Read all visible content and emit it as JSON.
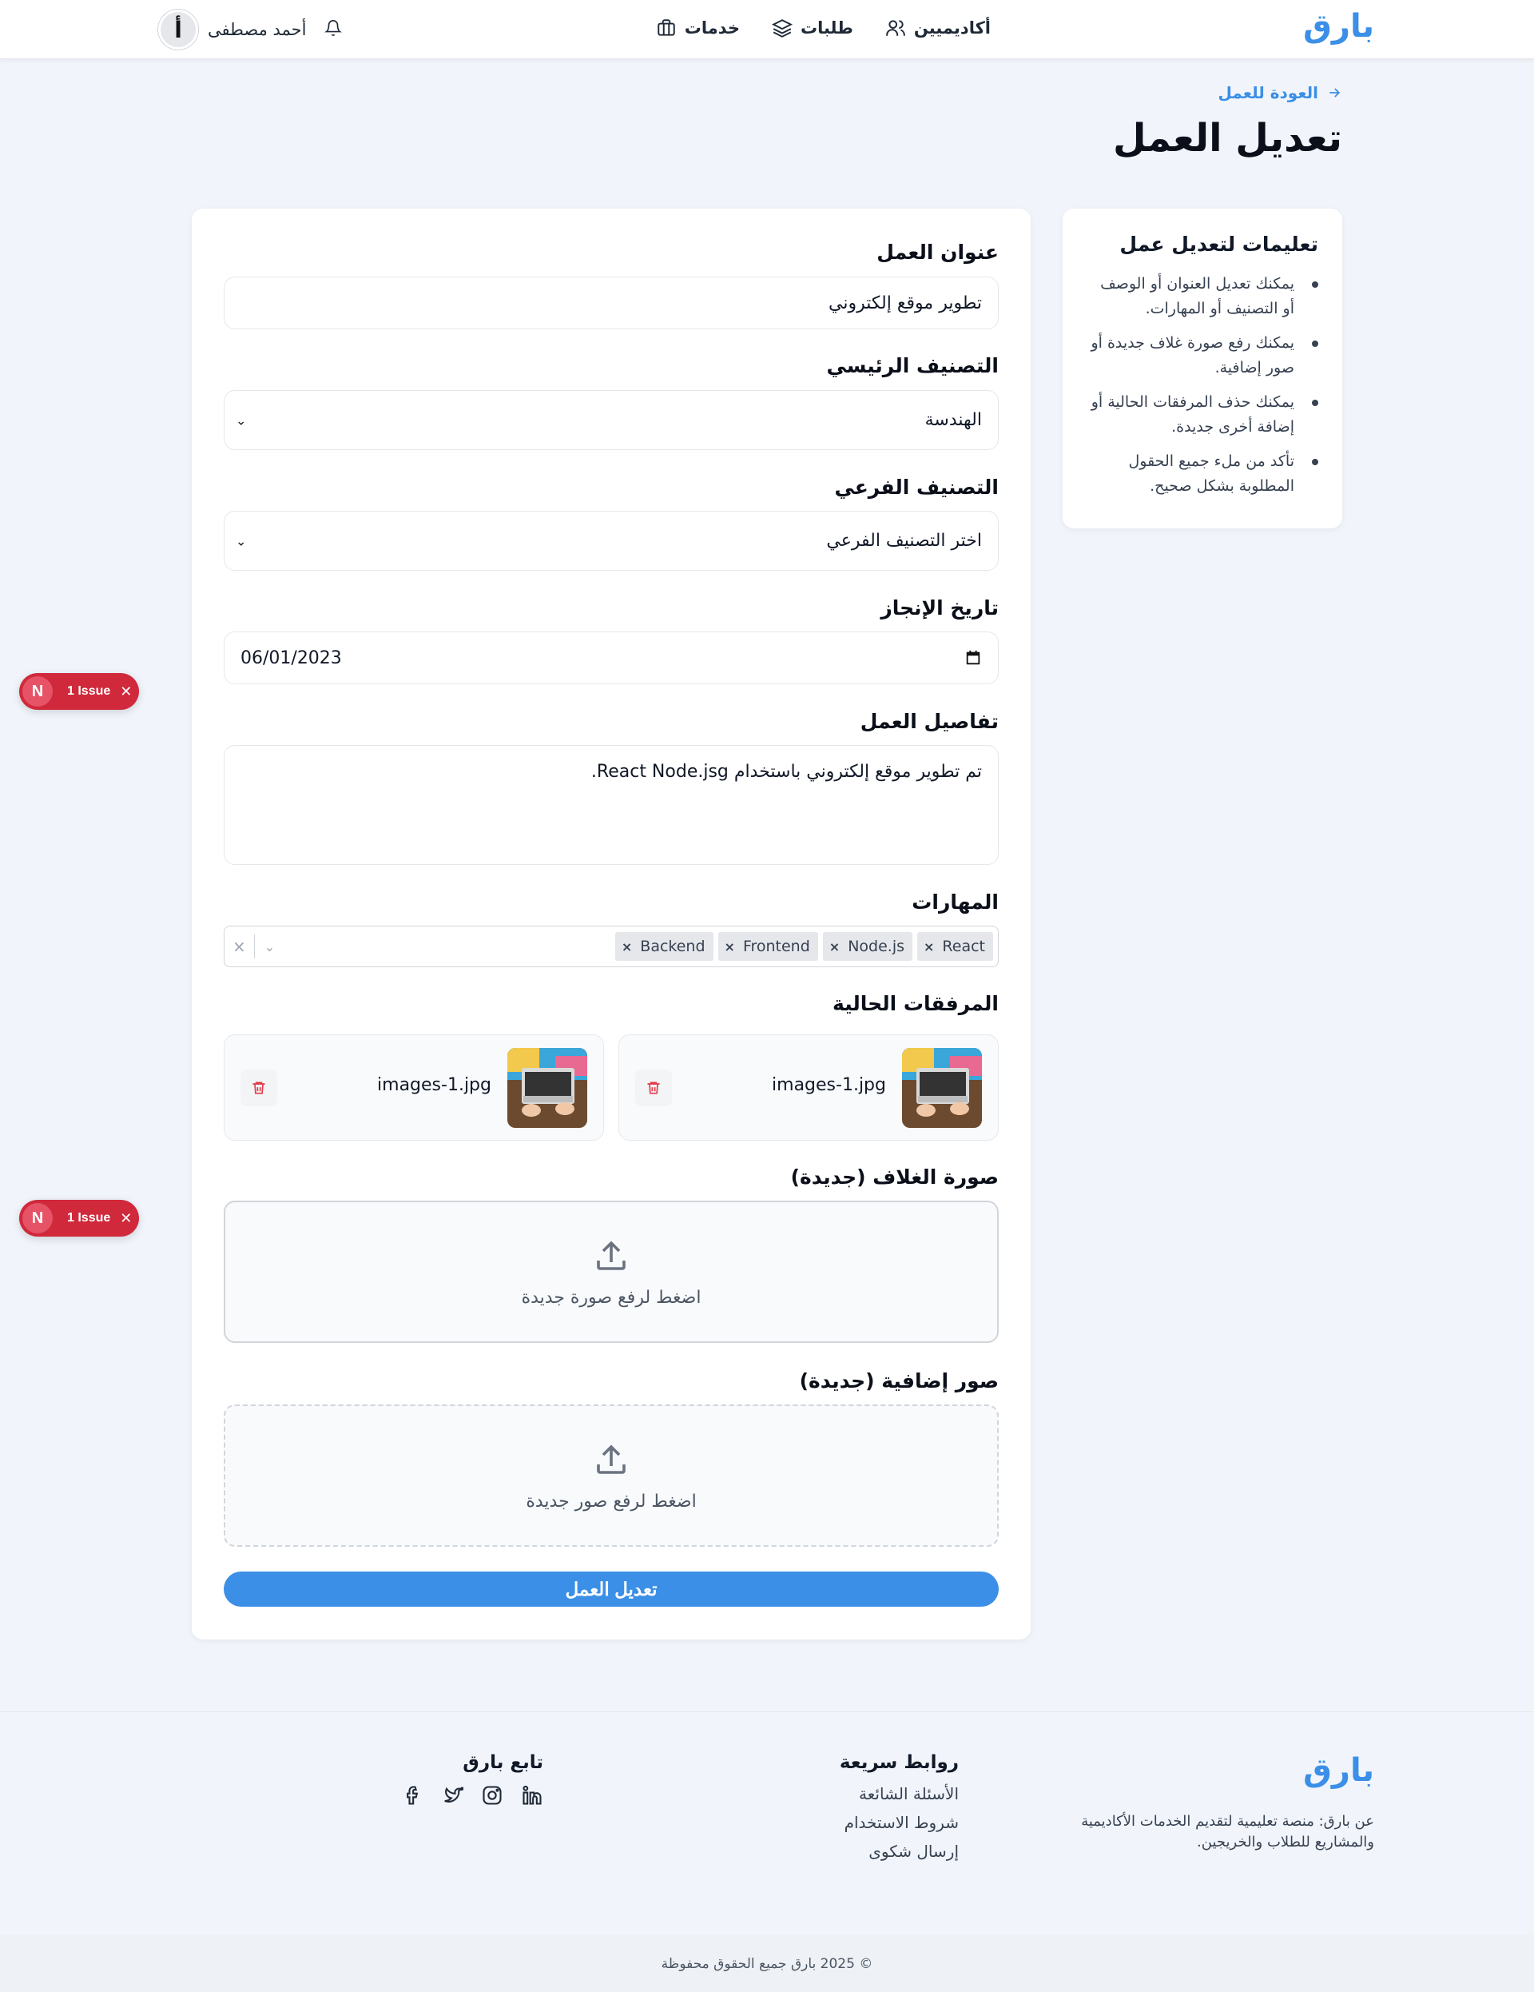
{
  "header": {
    "logo": "بارق",
    "nav": [
      {
        "label": "خدمات",
        "icon": "briefcase-icon"
      },
      {
        "label": "طلبات",
        "icon": "layers-icon"
      },
      {
        "label": "أكاديميين",
        "icon": "users-icon"
      }
    ],
    "user_name": "أحمد مصطفى",
    "avatar_letter": "أ"
  },
  "back_link": "العودة للعمل",
  "page_title": "تعديل العمل",
  "instructions": {
    "title": "تعليمات لتعديل عمل",
    "items": [
      "يمكنك تعديل العنوان أو الوصف أو التصنيف أو المهارات.",
      "يمكنك رفع صورة غلاف جديدة أو صور إضافية.",
      "يمكنك حذف المرفقات الحالية أو إضافة أخرى جديدة.",
      "تأكد من ملء جميع الحقول المطلوبة بشكل صحيح."
    ]
  },
  "form": {
    "title_label": "عنوان العمل",
    "title_value": "تطوير موقع إلكتروني",
    "main_category_label": "التصنيف الرئيسي",
    "main_category_value": "الهندسة",
    "sub_category_label": "التصنيف الفرعي",
    "sub_category_value": "اختر التصنيف الفرعي",
    "date_label": "تاريخ الإنجاز",
    "date_value": "06/01/2023",
    "details_label": "تفاصيل العمل",
    "details_value": "تم تطوير موقع إلكتروني باستخدام React Node.jsg.",
    "skills_label": "المهارات",
    "skills": [
      "React",
      "Node.js",
      "Frontend",
      "Backend"
    ],
    "attachments_label": "المرفقات الحالية",
    "attachments": [
      {
        "name": "images-1.jpg"
      },
      {
        "name": "images-1.jpg"
      }
    ],
    "cover_label": "صورة الغلاف (جديدة)",
    "cover_upload_text": "اضغط لرفع صورة جديدة",
    "extra_label": "صور إضافية (جديدة)",
    "extra_upload_text": "اضغط لرفع صور جديدة",
    "submit_label": "تعديل العمل"
  },
  "issues": {
    "letter": "N",
    "label": "1 Issue"
  },
  "footer": {
    "logo": "بارق",
    "about": "عن بارق: منصة تعليمية لتقديم الخدمات الأكاديمية والمشاريع للطلاب والخريجين.",
    "links_title": "روابط سريعة",
    "links": [
      "الأسئلة الشائعة",
      "شروط الاستخدام",
      "إرسال شكوى"
    ],
    "follow_title": "تابع بارق",
    "socials": [
      "facebook-icon",
      "twitter-icon",
      "instagram-icon",
      "linkedin-icon"
    ],
    "copyright": "© 2025 بارق جميع الحقوق محفوظة"
  },
  "colors": {
    "accent": "#3b8fe6",
    "issue": "#d0293b",
    "background": "#f1f5fb"
  }
}
